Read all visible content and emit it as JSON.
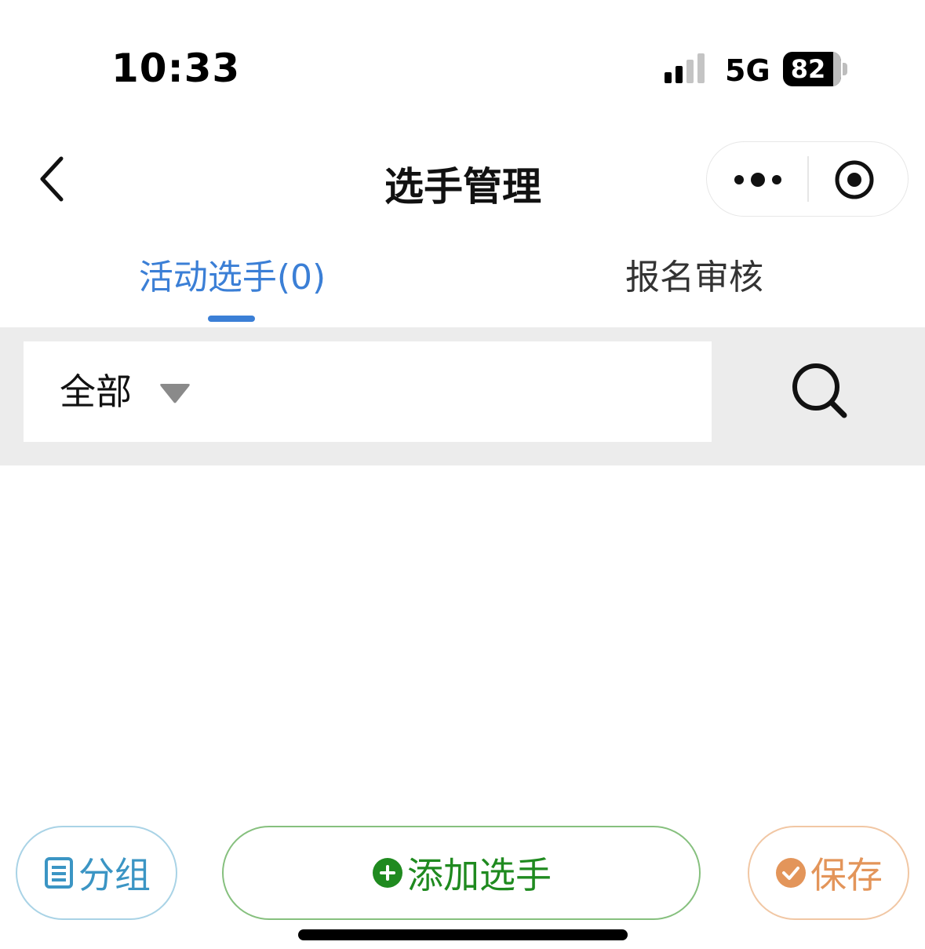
{
  "status_bar": {
    "time": "10:33",
    "network": "5G",
    "battery": "82",
    "signal_icon": "cellular-signal-icon"
  },
  "nav": {
    "title": "选手管理",
    "back_icon": "chevron-left-icon",
    "more_icon": "more-dots-icon",
    "close_icon": "target-circle-icon"
  },
  "tabs": [
    {
      "label": "活动选手(0)",
      "active": true
    },
    {
      "label": "报名审核",
      "active": false
    }
  ],
  "filter": {
    "selected": "全部",
    "dropdown_icon": "triangle-down-icon",
    "search_icon": "search-icon"
  },
  "buttons": {
    "group": {
      "label": "分组",
      "icon": "list-doc-icon"
    },
    "add": {
      "label": "添加选手",
      "icon": "plus-circle-icon"
    },
    "save": {
      "label": "保存",
      "icon": "check-circle-icon"
    }
  },
  "colors": {
    "accent": "#3b7fd6",
    "add_green": "#1f8a1f",
    "save_orange": "#e3955a",
    "group_blue": "#3b95c4",
    "filter_band": "#ececec"
  }
}
